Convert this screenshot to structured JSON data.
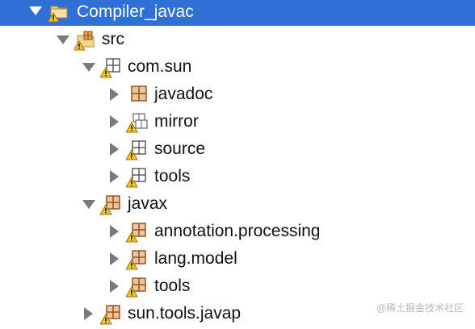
{
  "tree": {
    "project": {
      "label": "Compiler_javac",
      "icon": "project-folder-warning-icon"
    },
    "src": {
      "label": "src",
      "icon": "source-folder-warning-icon"
    },
    "com_sun": {
      "label": "com.sun",
      "icon": "package-warning-icon",
      "children": [
        {
          "label": "javadoc",
          "icon": "package-icon"
        },
        {
          "label": "mirror",
          "icon": "package-warning-icon"
        },
        {
          "label": "source",
          "icon": "package-warning-icon"
        },
        {
          "label": "tools",
          "icon": "package-warning-icon"
        }
      ]
    },
    "javax": {
      "label": "javax",
      "icon": "package-warning-icon",
      "children": [
        {
          "label": "annotation.processing",
          "icon": "package-warning-icon"
        },
        {
          "label": "lang.model",
          "icon": "package-warning-icon"
        },
        {
          "label": "tools",
          "icon": "package-warning-icon"
        }
      ]
    },
    "sun_tools_javap": {
      "label": "sun.tools.javap",
      "icon": "package-warning-icon"
    }
  },
  "watermark": "@稀土掘金技术社区",
  "colors": {
    "selection": "#2f6fd6",
    "package": "#c8763a",
    "warning": "#e3b01c"
  }
}
